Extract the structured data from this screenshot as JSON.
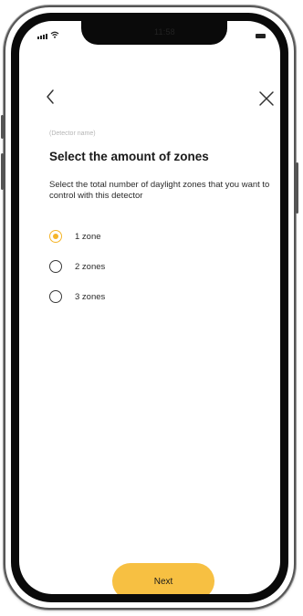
{
  "status_bar": {
    "time": "11:58"
  },
  "nav": {
    "back_icon": "chevron-left-icon",
    "close_icon": "close-icon"
  },
  "content": {
    "device_name": "(Detector name)",
    "title": "Select the amount of zones",
    "description": "Select the total number of daylight zones that you want to control with this detector"
  },
  "options": [
    {
      "label": "1 zone",
      "selected": true
    },
    {
      "label": "2 zones",
      "selected": false
    },
    {
      "label": "3 zones",
      "selected": false
    }
  ],
  "footer": {
    "next_label": "Next"
  },
  "colors": {
    "accent": "#f7c042",
    "radio_selected": "#f5b52a",
    "text": "#1a1a1a",
    "muted": "#b5b5b5"
  }
}
